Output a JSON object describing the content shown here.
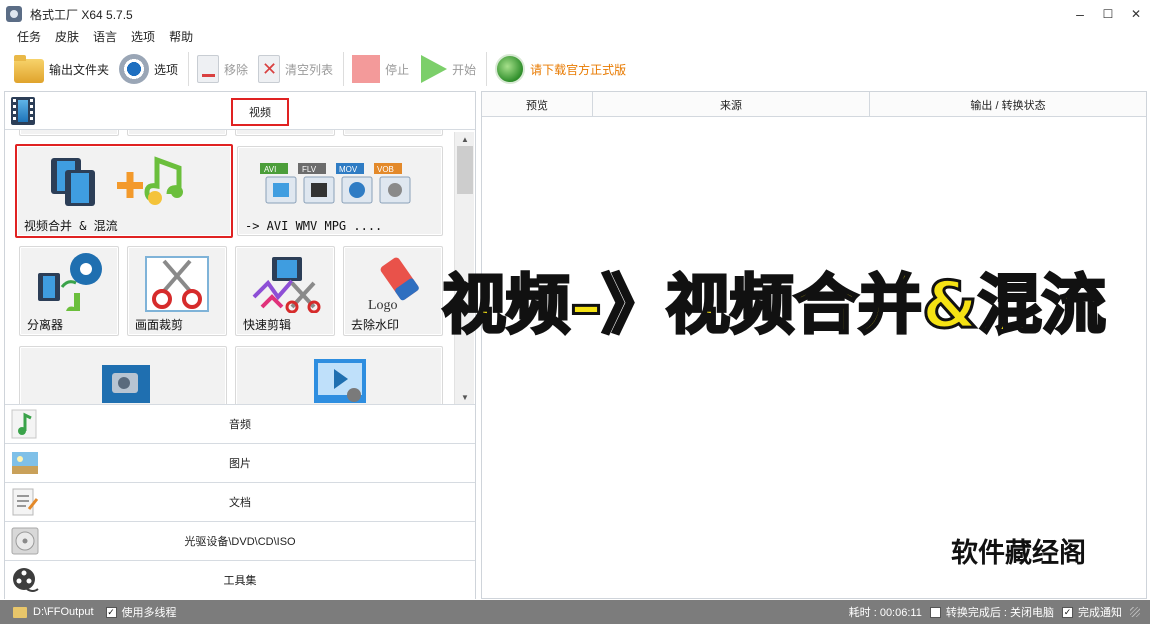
{
  "window": {
    "title": "格式工厂 X64 5.7.5",
    "minimize": "–",
    "maximize": "☐",
    "close": "✕"
  },
  "menu": [
    "任务",
    "皮肤",
    "语言",
    "选项",
    "帮助"
  ],
  "toolbar": {
    "output_folder": "输出文件夹",
    "options": "选项",
    "remove": "移除",
    "clear_list": "清空列表",
    "stop": "停止",
    "start": "开始",
    "download_link": "请下载官方正式版",
    "link_color": "#e87a00"
  },
  "left_panel": {
    "video_category": "视频",
    "tiles": [
      {
        "label": "视频合并 & 混流",
        "icon": "merge-mix-icon",
        "highlighted": true
      },
      {
        "label": "-> AVI WMV MPG ....",
        "icon": "format-convert-icon",
        "badges": [
          "AVI",
          "FLV",
          "MOV",
          "VOB"
        ]
      },
      {
        "label": "分离器",
        "icon": "splitter-icon"
      },
      {
        "label": "画面裁剪",
        "icon": "crop-icon"
      },
      {
        "label": "快速剪辑",
        "icon": "quick-clip-icon"
      },
      {
        "label": "去除水印",
        "icon": "remove-watermark-icon",
        "art_text": "Logo"
      },
      {
        "label": "",
        "icon": "camera-video-icon"
      },
      {
        "label": "",
        "icon": "player-video-icon"
      }
    ],
    "categories": [
      {
        "label": "音频",
        "icon": "music-note-icon"
      },
      {
        "label": "图片",
        "icon": "picture-icon"
      },
      {
        "label": "文档",
        "icon": "document-icon"
      },
      {
        "label": "光驱设备\\DVD\\CD\\ISO",
        "icon": "disc-icon"
      },
      {
        "label": "工具集",
        "icon": "film-reel-icon"
      }
    ]
  },
  "task_list": {
    "columns": [
      "预览",
      "来源",
      "输出 / 转换状态"
    ]
  },
  "overlay": {
    "headline": "视频–》视频合并&混流",
    "headline_color": "#f5e214",
    "watermark": "软件藏经阁"
  },
  "status": {
    "output_path": "D:\\FFOutput",
    "multithread_label": "使用多线程",
    "multithread_checked": true,
    "elapsed": "耗时 : 00:06:11",
    "after_complete": "转换完成后 : 关闭电脑",
    "after_complete_checked": false,
    "notify": "完成通知",
    "notify_checked": true
  }
}
